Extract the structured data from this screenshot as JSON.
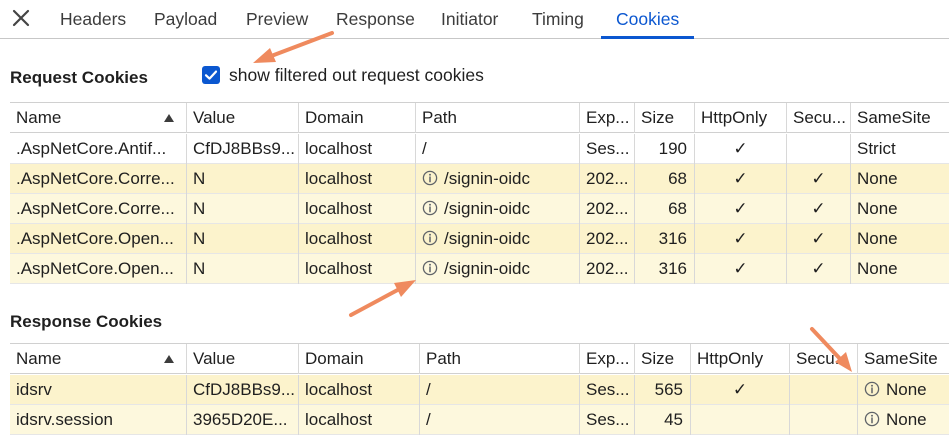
{
  "tabs": [
    "Headers",
    "Payload",
    "Preview",
    "Response",
    "Initiator",
    "Timing",
    "Cookies"
  ],
  "active_tab": "Cookies",
  "request_section": {
    "title": "Request Cookies",
    "checkbox_label": "show filtered out request cookies",
    "checkbox_checked": true
  },
  "response_section": {
    "title": "Response Cookies"
  },
  "columns": [
    "Name",
    "Value",
    "Domain",
    "Path",
    "Exp...",
    "Size",
    "HttpOnly",
    "Secu...",
    "SameSite"
  ],
  "request_rows": [
    {
      "name": ".AspNetCore.Antif...",
      "value": "CfDJ8BBs9...",
      "domain": "localhost",
      "path": "/",
      "expires": "Ses...",
      "size": "190",
      "httponly": "✓",
      "secure": "",
      "samesite": "Strict",
      "path_info": false,
      "samesite_info": false
    },
    {
      "name": ".AspNetCore.Corre...",
      "value": "N",
      "domain": "localhost",
      "path": "/signin-oidc",
      "expires": "202...",
      "size": "68",
      "httponly": "✓",
      "secure": "✓",
      "samesite": "None",
      "path_info": true,
      "samesite_info": false
    },
    {
      "name": ".AspNetCore.Corre...",
      "value": "N",
      "domain": "localhost",
      "path": "/signin-oidc",
      "expires": "202...",
      "size": "68",
      "httponly": "✓",
      "secure": "✓",
      "samesite": "None",
      "path_info": true,
      "samesite_info": false
    },
    {
      "name": ".AspNetCore.Open...",
      "value": "N",
      "domain": "localhost",
      "path": "/signin-oidc",
      "expires": "202...",
      "size": "316",
      "httponly": "✓",
      "secure": "✓",
      "samesite": "None",
      "path_info": true,
      "samesite_info": false
    },
    {
      "name": ".AspNetCore.Open...",
      "value": "N",
      "domain": "localhost",
      "path": "/signin-oidc",
      "expires": "202...",
      "size": "316",
      "httponly": "✓",
      "secure": "✓",
      "samesite": "None",
      "path_info": true,
      "samesite_info": false
    }
  ],
  "response_rows": [
    {
      "name": "idsrv",
      "value": "CfDJ8BBs9...",
      "domain": "localhost",
      "path": "/",
      "expires": "Ses...",
      "size": "565",
      "httponly": "✓",
      "secure": "",
      "samesite": "None",
      "path_info": false,
      "samesite_info": true
    },
    {
      "name": "idsrv.session",
      "value": "3965D20E...",
      "domain": "localhost",
      "path": "/",
      "expires": "Ses...",
      "size": "45",
      "httponly": "",
      "secure": "",
      "samesite": "None",
      "path_info": false,
      "samesite_info": true
    }
  ],
  "colors": {
    "accent": "#0b57d0",
    "row_highlight": "#fcf3cc",
    "row_highlight_alt": "#fdf8dd",
    "annotation_arrow": "#ef8a5e"
  },
  "icons": {
    "close": "close-icon",
    "sort": "sort-ascending-icon",
    "info": "info-icon",
    "checkbox": "checkmark-icon"
  }
}
